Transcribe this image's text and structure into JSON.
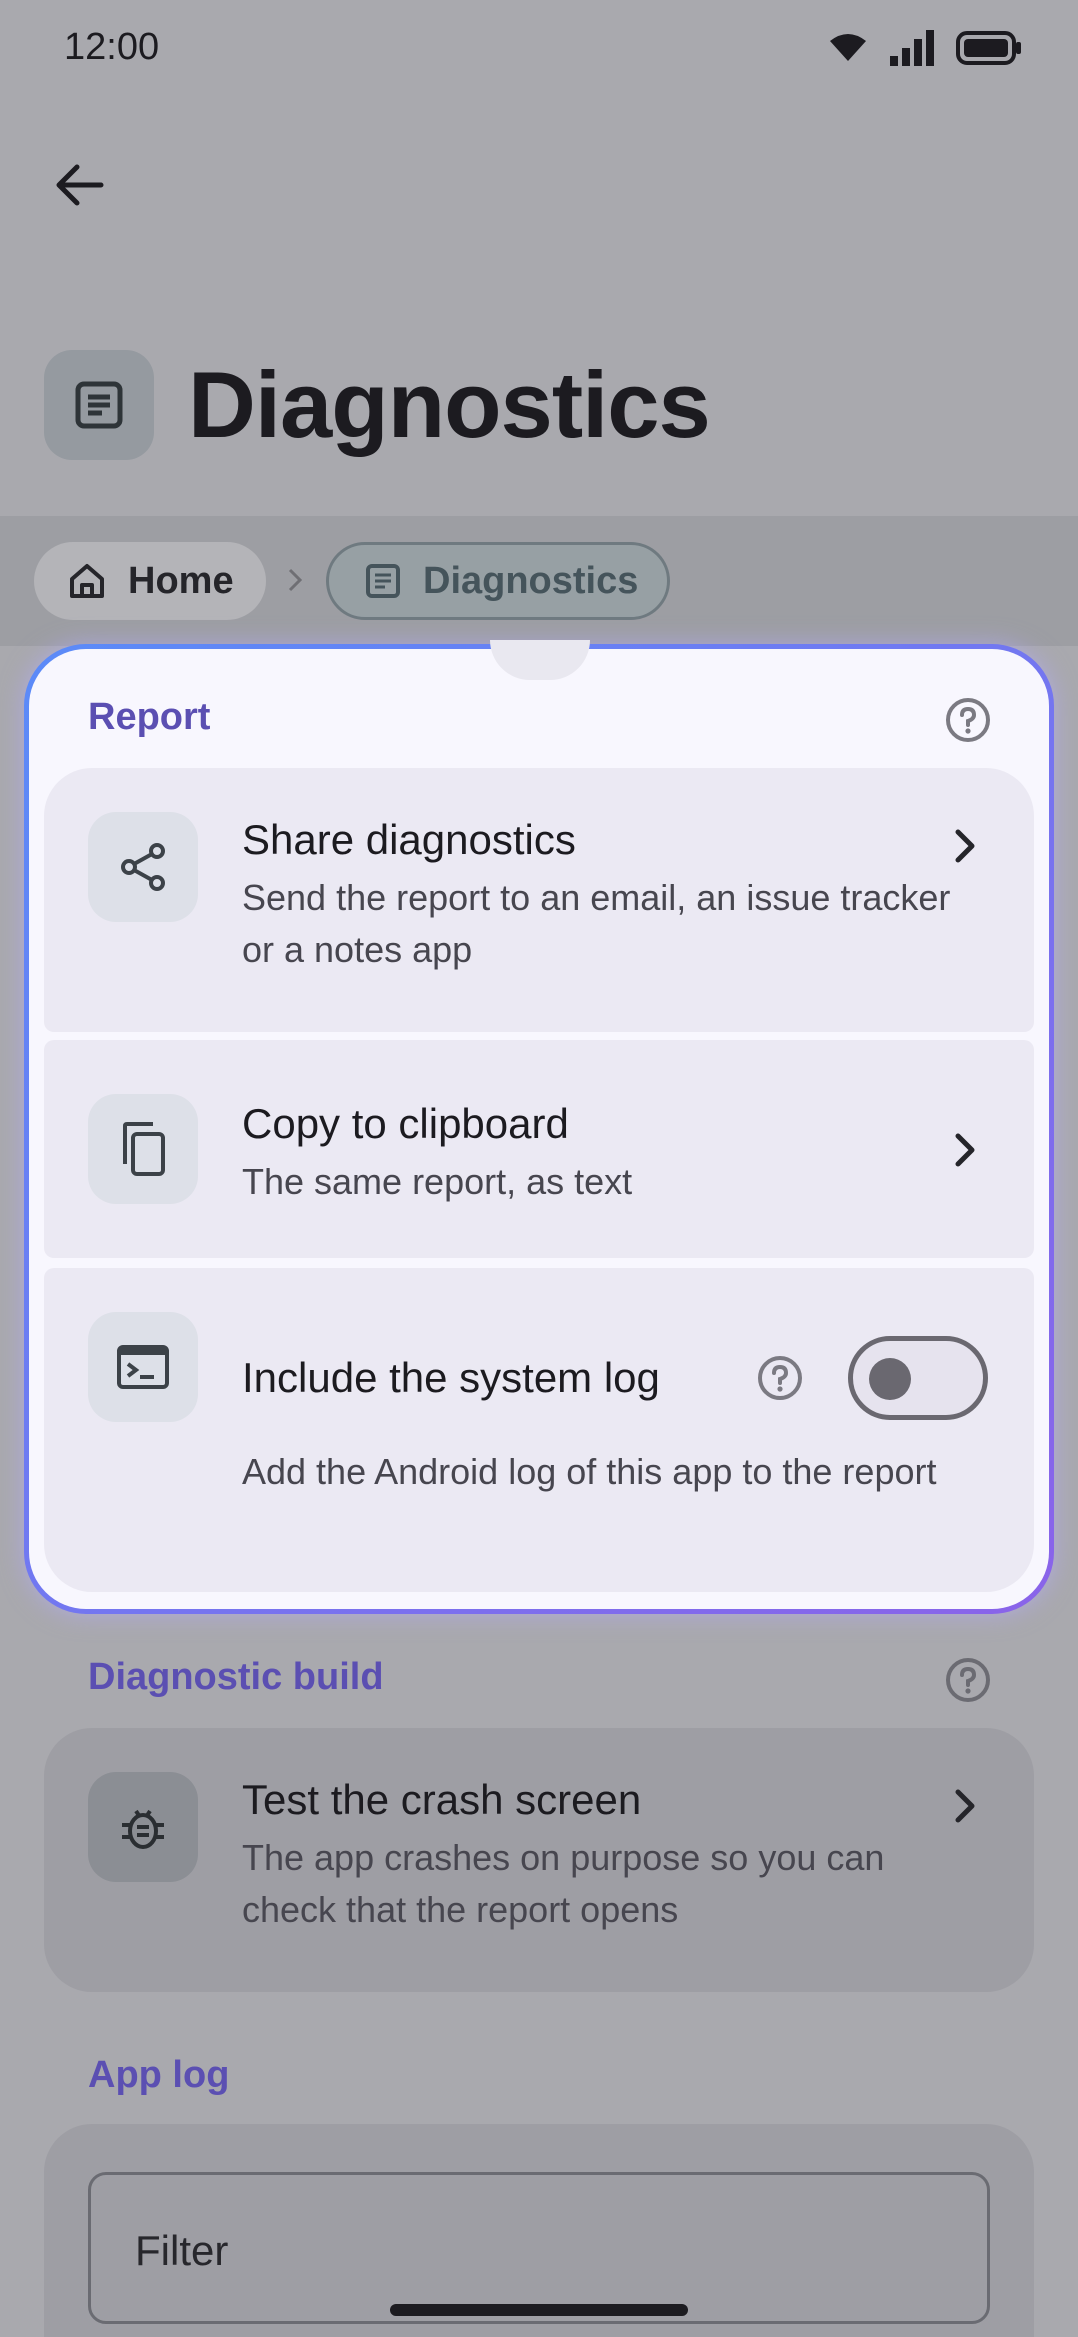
{
  "status": {
    "time": "12:00"
  },
  "header": {
    "title": "Diagnostics"
  },
  "breadcrumb": {
    "home": "Home",
    "current": "Diagnostics"
  },
  "report": {
    "title": "Report",
    "items": [
      {
        "title": "Share diagnostics",
        "subtitle": "Send the report to an email, an issue tracker or a notes app"
      },
      {
        "title": "Copy to clipboard",
        "subtitle": "The same report, as text"
      },
      {
        "title": "Include the system log",
        "subtitle": "Add the Android log of this app to the report",
        "toggle_on": false
      }
    ]
  },
  "diagnostic_build": {
    "title": "Diagnostic build",
    "item": {
      "title": "Test the crash screen",
      "subtitle": "The app crashes on purpose so you can check that the report opens"
    }
  },
  "app_log": {
    "title": "App log",
    "filter_placeholder": "Filter"
  },
  "colors": {
    "accent": "#5b4fb2",
    "highlight_start": "#5b8bf8",
    "highlight_end": "#8a63e9"
  }
}
